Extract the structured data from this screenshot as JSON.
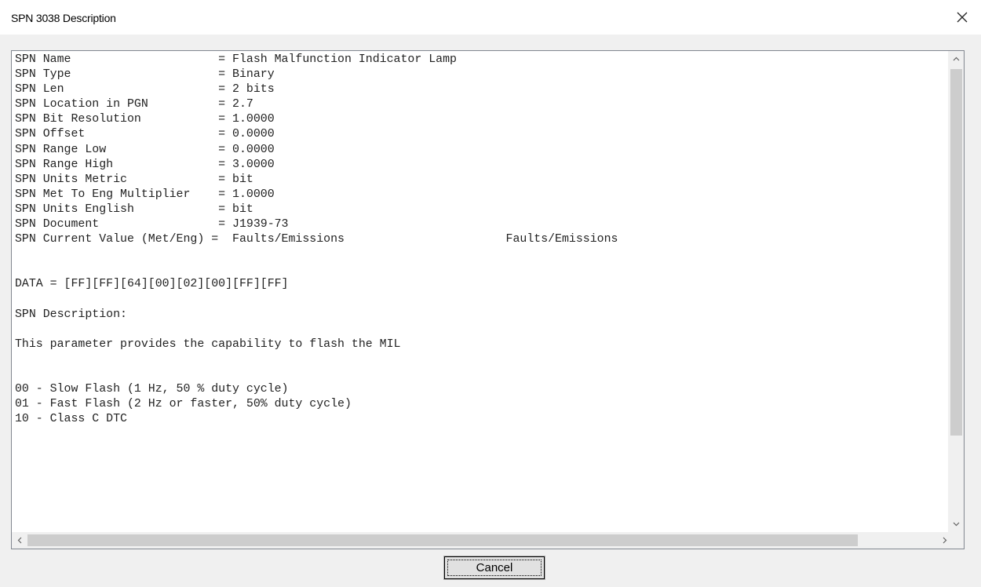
{
  "window": {
    "title": "SPN  3038 Description",
    "close_icon": "close-icon"
  },
  "content": {
    "lines": [
      "SPN Name                     = Flash Malfunction Indicator Lamp",
      "SPN Type                     = Binary",
      "SPN Len                      = 2 bits",
      "SPN Location in PGN          = 2.7",
      "SPN Bit Resolution           = 1.0000",
      "SPN Offset                   = 0.0000",
      "SPN Range Low                = 0.0000",
      "SPN Range High               = 3.0000",
      "SPN Units Metric             = bit",
      "SPN Met To Eng Multiplier    = 1.0000",
      "SPN Units English            = bit",
      "SPN Document                 = J1939-73",
      "SPN Current Value (Met/Eng) =  Faults/Emissions                       Faults/Emissions",
      "",
      "",
      "DATA = [FF][FF][64][00][02][00][FF][FF]",
      "",
      "SPN Description:",
      "",
      "This parameter provides the capability to flash the MIL",
      "",
      "",
      "00 - Slow Flash (1 Hz, 50 % duty cycle)",
      "01 - Fast Flash (2 Hz or faster, 50% duty cycle)",
      "10 - Class C DTC",
      ""
    ]
  },
  "buttons": {
    "cancel_label": "Cancel"
  },
  "icons": {
    "scroll_up": "chevron-up-icon",
    "scroll_down": "chevron-down-icon",
    "scroll_left": "chevron-left-icon",
    "scroll_right": "chevron-right-icon"
  }
}
